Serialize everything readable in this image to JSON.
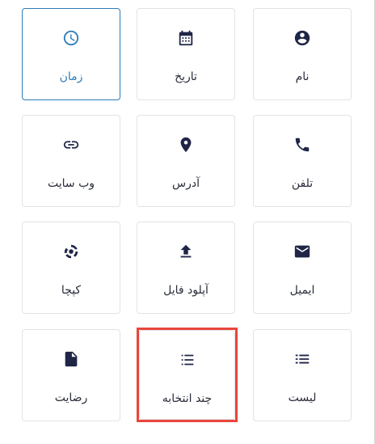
{
  "fields": [
    {
      "key": "time",
      "label": "زمان",
      "icon": "clock-icon",
      "selected": true
    },
    {
      "key": "date",
      "label": "تاریخ",
      "icon": "calendar-icon"
    },
    {
      "key": "name",
      "label": "نام",
      "icon": "account-circle-icon"
    },
    {
      "key": "website",
      "label": "وب سایت",
      "icon": "link-icon"
    },
    {
      "key": "address",
      "label": "آدرس",
      "icon": "map-pin-icon"
    },
    {
      "key": "phone",
      "label": "تلفن",
      "icon": "phone-icon"
    },
    {
      "key": "captcha",
      "label": "کپچا",
      "icon": "captcha-icon"
    },
    {
      "key": "file-upload",
      "label": "آپلود فایل",
      "icon": "upload-icon"
    },
    {
      "key": "email",
      "label": "ایمیل",
      "icon": "mail-icon"
    },
    {
      "key": "rating",
      "label": "رضایت",
      "icon": "document-icon"
    },
    {
      "key": "multi-select",
      "label": "چند انتخابه",
      "icon": "checklist-icon",
      "highlighted": true
    },
    {
      "key": "list",
      "label": "لیست",
      "icon": "list-icon"
    }
  ],
  "colors": {
    "accent": "#2c7bb8",
    "icon": "#1f2547",
    "highlight": "#e8453c"
  }
}
